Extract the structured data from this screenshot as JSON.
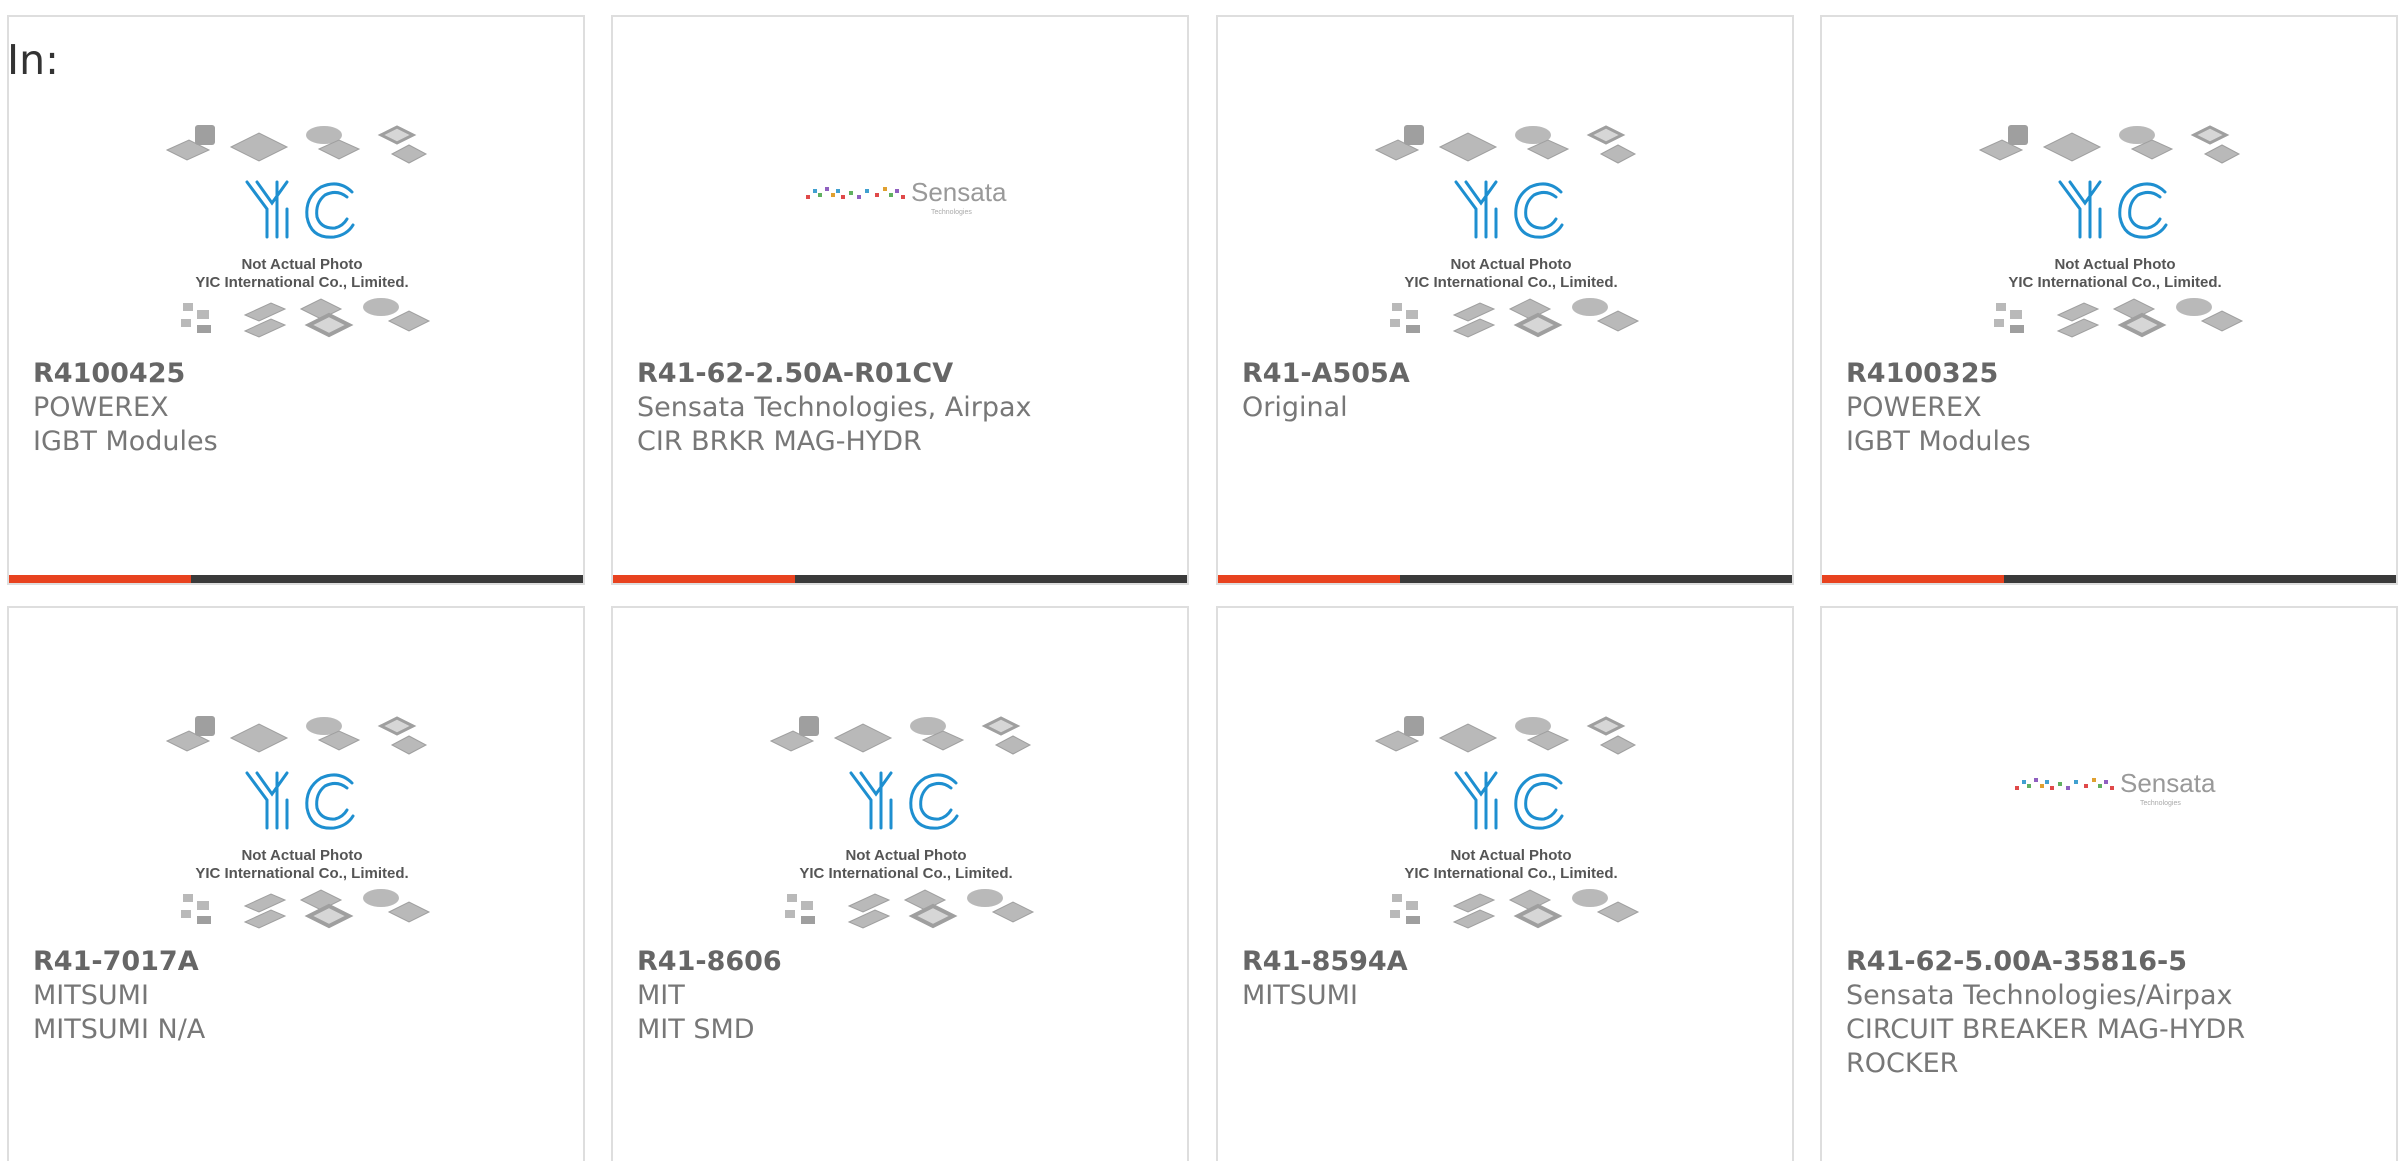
{
  "header": {
    "label": "In:"
  },
  "colors": {
    "accent": "#e8421f",
    "bar_dark": "#3a3a3a",
    "card_border": "#dedede",
    "logo_blue": "#1e8fd0",
    "sensata_red": "#c83c3c"
  },
  "placeholder": {
    "line1": "Not Actual Photo",
    "line2": "YIC International Co., Limited."
  },
  "sensata": {
    "name": "Sensata",
    "sub": "Technologies"
  },
  "products": [
    {
      "image": "yic-placeholder",
      "part": "R4100425",
      "lines": [
        "POWEREX",
        "IGBT Modules"
      ]
    },
    {
      "image": "sensata-logo",
      "part": "R41-62-2.50A-R01CV",
      "lines": [
        "Sensata Technologies, Airpax",
        "CIR BRKR MAG-HYDR"
      ]
    },
    {
      "image": "yic-placeholder",
      "part": "R41-A505A",
      "lines": [
        "Original"
      ]
    },
    {
      "image": "yic-placeholder",
      "part": "R4100325",
      "lines": [
        "POWEREX",
        "IGBT Modules"
      ]
    },
    {
      "image": "yic-placeholder",
      "part": "R41-7017A",
      "lines": [
        "MITSUMI",
        "MITSUMI N/A"
      ]
    },
    {
      "image": "yic-placeholder",
      "part": "R41-8606",
      "lines": [
        "MIT",
        "MIT SMD"
      ]
    },
    {
      "image": "yic-placeholder",
      "part": "R41-8594A",
      "lines": [
        "MITSUMI"
      ]
    },
    {
      "image": "sensata-logo",
      "part": "R41-62-5.00A-35816-5",
      "lines": [
        "Sensata Technologies/Airpax",
        "CIRCUIT BREAKER MAG-HYDR",
        "ROCKER"
      ]
    }
  ]
}
